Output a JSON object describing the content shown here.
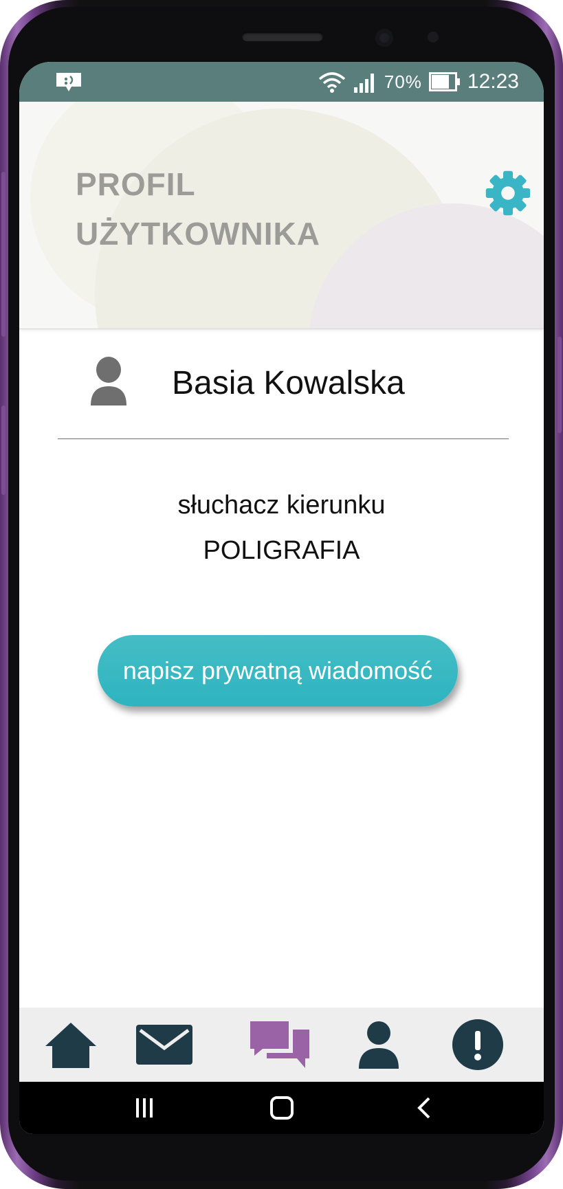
{
  "status_bar": {
    "battery_percent": "70%",
    "time": "12:23",
    "icons": [
      "notification-icon",
      "wifi-icon",
      "signal-icon",
      "battery-icon"
    ]
  },
  "header": {
    "title_line1": "PROFIL",
    "title_line2": "UŻYTKOWNIKA",
    "settings_icon": "gear-icon",
    "gear_color": "#3ab5c6"
  },
  "profile": {
    "name": "Basia Kowalska",
    "role_line1": "słuchacz kierunku",
    "role_line2": "POLIGRAFIA"
  },
  "actions": {
    "message_button_label": "napisz prywatną wiadomość",
    "button_color": "#3bb8c3"
  },
  "bottom_nav": {
    "items": [
      {
        "icon": "home-icon"
      },
      {
        "icon": "mail-icon"
      },
      {
        "icon": "chat-icon",
        "active": true
      },
      {
        "icon": "user-icon"
      },
      {
        "icon": "alert-icon"
      }
    ],
    "icon_color": "#1e3b47",
    "active_color": "#9a63a6"
  },
  "system_nav": {
    "items": [
      "recent-apps-icon",
      "home-button-icon",
      "back-icon"
    ]
  }
}
